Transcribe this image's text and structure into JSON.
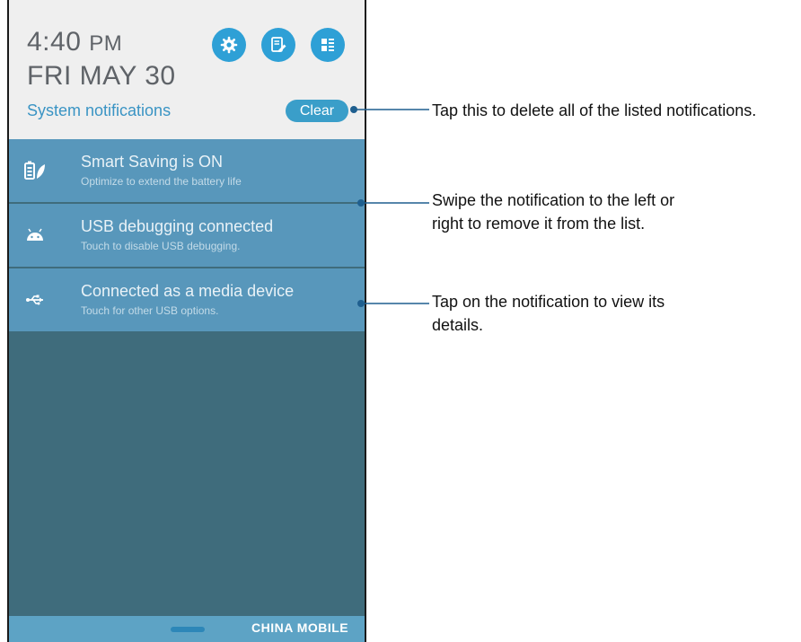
{
  "status": {
    "time": "4:40",
    "ampm": "PM",
    "date": "FRI MAY 30"
  },
  "header": {
    "system_notifications_label": "System notifications",
    "clear_label": "Clear"
  },
  "quick_buttons": [
    {
      "icon": "gear-icon"
    },
    {
      "icon": "edit-note-icon"
    },
    {
      "icon": "quick-settings-icon"
    }
  ],
  "notifications": [
    {
      "icon": "battery-leaf-icon",
      "title": "Smart Saving is ON",
      "subtitle": "Optimize to extend the battery life"
    },
    {
      "icon": "android-icon",
      "title": "USB debugging connected",
      "subtitle": "Touch to disable USB debugging."
    },
    {
      "icon": "usb-icon",
      "title": "Connected as a media device",
      "subtitle": "Touch for other USB options."
    }
  ],
  "carrier": "CHINA  MOBILE",
  "callouts": {
    "clear": "Tap this to delete all of the listed notifications.",
    "swipe_line1": "Swipe the notification to the left or",
    "swipe_line2": "right to remove it from the list.",
    "tap_line1": "Tap on the notification to view its",
    "tap_line2": "details."
  },
  "colors": {
    "accent": "#2ea0d6",
    "notification_bg": "#5897bb",
    "list_bg": "#3f6c7c",
    "header_bg": "#efefef"
  }
}
